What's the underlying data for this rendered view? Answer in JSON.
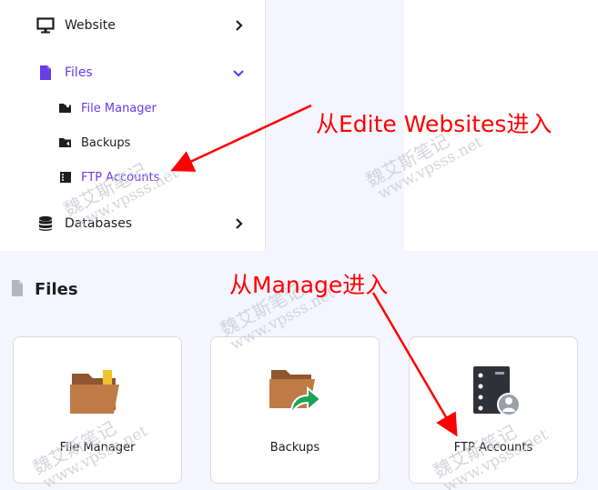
{
  "sidebar": {
    "items": [
      {
        "label": "Website"
      },
      {
        "label": "Files"
      },
      {
        "label": "Databases"
      }
    ],
    "files_subitems": [
      {
        "label": "File Manager"
      },
      {
        "label": "Backups"
      },
      {
        "label": "FTP Accounts"
      }
    ]
  },
  "files_section": {
    "title": "Files",
    "cards": [
      {
        "label": "File Manager"
      },
      {
        "label": "Backups"
      },
      {
        "label": "FTP Accounts"
      }
    ]
  },
  "annotations": {
    "top_note": "从Edite Websites进入",
    "bottom_note": "从Manage进入"
  },
  "watermark": {
    "cn": "魏艾斯笔记",
    "url": "www.vpsss.net"
  },
  "colors": {
    "accent": "#673de6",
    "annotation": "#ff0000",
    "folder": "#b8733f"
  }
}
